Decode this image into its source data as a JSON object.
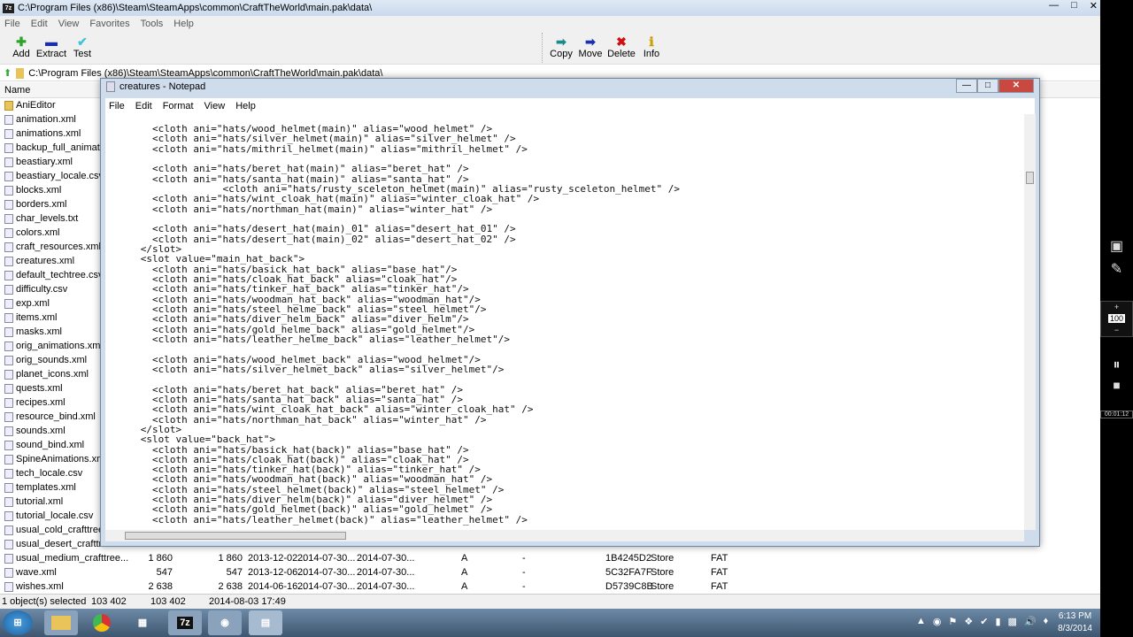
{
  "window": {
    "title": "C:\\Program Files (x86)\\Steam\\SteamApps\\common\\CraftTheWorld\\main.pak\\data\\",
    "app_icon": "7z"
  },
  "menu": [
    "File",
    "Edit",
    "View",
    "Favorites",
    "Tools",
    "Help"
  ],
  "toolbar": {
    "left": [
      {
        "label": "Add",
        "icon": "plus-icon",
        "color": "#2aa52a"
      },
      {
        "label": "Extract",
        "icon": "minus-icon",
        "color": "#1a2fb0"
      },
      {
        "label": "Test",
        "icon": "check-icon",
        "color": "#3cc6d8"
      }
    ],
    "right": [
      {
        "label": "Copy",
        "icon": "arrow-right-icon",
        "color": "#1a8a8a"
      },
      {
        "label": "Move",
        "icon": "arrow-right-icon",
        "color": "#1a2fb0"
      },
      {
        "label": "Delete",
        "icon": "x-icon",
        "color": "#d01010"
      },
      {
        "label": "Info",
        "icon": "info-icon",
        "color": "#c9a000"
      }
    ]
  },
  "address": "C:\\Program Files (x86)\\Steam\\SteamApps\\common\\CraftTheWorld\\main.pak\\data\\",
  "columns": {
    "name": "Name"
  },
  "files": [
    "AniEditor",
    "animation.xml",
    "animations.xml",
    "backup_full_animatio",
    "beastiary.xml",
    "beastiary_locale.csv",
    "blocks.xml",
    "borders.xml",
    "char_levels.txt",
    "colors.xml",
    "craft_resources.xml",
    "creatures.xml",
    "default_techtree.csv",
    "difficulty.csv",
    "exp.xml",
    "items.xml",
    "masks.xml",
    "orig_animations.xml",
    "orig_sounds.xml",
    "planet_icons.xml",
    "quests.xml",
    "recipes.xml",
    "resource_bind.xml",
    "sounds.xml",
    "sound_bind.xml",
    "SpineAnimations.xml",
    "tech_locale.csv",
    "templates.xml",
    "tutorial.xml",
    "tutorial_locale.csv",
    "usual_cold_crafttree.c",
    "usual_desert_crafttree"
  ],
  "visible_rows": [
    {
      "name": "usual_medium_crafttree...",
      "size": "1 860",
      "packed": "1 860",
      "modified": "2013-12-02...",
      "created": "2014-07-30...",
      "accessed": "2014-07-30...",
      "attr": "A",
      "enc": "-",
      "crc": "1B4245D2",
      "method": "Store",
      "host": "FAT"
    },
    {
      "name": "wave.xml",
      "size": "547",
      "packed": "547",
      "modified": "2013-12-06...",
      "created": "2014-07-30...",
      "accessed": "2014-07-30...",
      "attr": "A",
      "enc": "-",
      "crc": "5C32FA7F",
      "method": "Store",
      "host": "FAT"
    },
    {
      "name": "wishes.xml",
      "size": "2 638",
      "packed": "2 638",
      "modified": "2014-06-16...",
      "created": "2014-07-30...",
      "accessed": "2014-07-30...",
      "attr": "A",
      "enc": "-",
      "crc": "D5739C8B",
      "method": "Store",
      "host": "FAT"
    }
  ],
  "status": {
    "selected": "1 object(s) selected",
    "size": "103 402",
    "packed": "103 402",
    "date": "2014-08-03 17:49"
  },
  "notepad": {
    "title": "creatures - Notepad",
    "menu": [
      "File",
      "Edit",
      "Format",
      "View",
      "Help"
    ],
    "text": "        <cloth ani=\"hats/wood_helmet(main)\" alias=\"wood_helmet\" />\n        <cloth ani=\"hats/silver_helmet(main)\" alias=\"silver_helmet\" />\n        <cloth ani=\"hats/mithril_helmet(main)\" alias=\"mithril_helmet\" />\n\n        <cloth ani=\"hats/beret_hat(main)\" alias=\"beret_hat\" />\n        <cloth ani=\"hats/santa_hat(main)\" alias=\"santa_hat\" />\n                    <cloth ani=\"hats/rusty_sceleton_helmet(main)\" alias=\"rusty_sceleton_helmet\" />\n        <cloth ani=\"hats/wint_cloak_hat(main)\" alias=\"winter_cloak_hat\" />\n        <cloth ani=\"hats/northman_hat(main)\" alias=\"winter_hat\" />\n\n        <cloth ani=\"hats/desert_hat(main)_01\" alias=\"desert_hat_01\" />\n        <cloth ani=\"hats/desert_hat(main)_02\" alias=\"desert_hat_02\" />\n      </slot>\n      <slot value=\"main_hat_back\">\n        <cloth ani=\"hats/basick_hat_back\" alias=\"base_hat\"/>\n        <cloth ani=\"hats/cloak_hat_back\" alias=\"cloak_hat\"/>\n        <cloth ani=\"hats/tinker_hat_back\" alias=\"tinker_hat\"/>\n        <cloth ani=\"hats/woodman_hat_back\" alias=\"woodman_hat\"/>\n        <cloth ani=\"hats/steel_helme_back\" alias=\"steel_helmet\"/>\n        <cloth ani=\"hats/diver_helm_back\" alias=\"diver_helm\"/>\n        <cloth ani=\"hats/gold_helme_back\" alias=\"gold_helmet\"/>\n        <cloth ani=\"hats/leather_helme_back\" alias=\"leather_helmet\"/>\n\n        <cloth ani=\"hats/wood_helmet_back\" alias=\"wood_helmet\"/>\n        <cloth ani=\"hats/silver_helmet_back\" alias=\"silver_helmet\"/>\n\n        <cloth ani=\"hats/beret_hat_back\" alias=\"beret_hat\" />\n        <cloth ani=\"hats/santa_hat_back\" alias=\"santa_hat\" />\n        <cloth ani=\"hats/wint_cloak_hat_back\" alias=\"winter_cloak_hat\" />\n        <cloth ani=\"hats/northman_hat_back\" alias=\"winter_hat\" />\n      </slot>\n      <slot value=\"back_hat\">\n        <cloth ani=\"hats/basick_hat(back)\" alias=\"base_hat\" />\n        <cloth ani=\"hats/cloak_hat(back)\" alias=\"cloak_hat\" />\n        <cloth ani=\"hats/tinker_hat(back)\" alias=\"tinker_hat\" />\n        <cloth ani=\"hats/woodman_hat(back)\" alias=\"woodman_hat\" />\n        <cloth ani=\"hats/steel_helmet(back)\" alias=\"steel_helmet\" />\n        <cloth ani=\"hats/diver_helm(back)\" alias=\"diver_helmet\" />\n        <cloth ani=\"hats/gold_helmet(back)\" alias=\"gold_helmet\" />\n        <cloth ani=\"hats/leather_helmet(back)\" alias=\"leather_helmet\" />"
  },
  "recorder": {
    "zoom": "100",
    "timer": "00:01:12"
  },
  "clock": {
    "time": "6:13 PM",
    "date": "8/3/2014"
  }
}
